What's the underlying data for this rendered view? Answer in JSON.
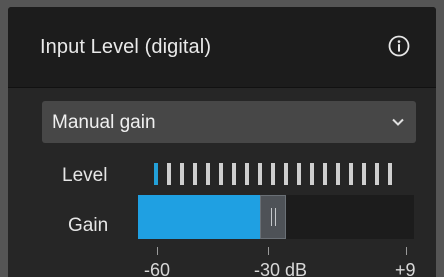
{
  "panel": {
    "title": "Input Level (digital)",
    "info_icon": "info-circle-icon"
  },
  "gain_mode": {
    "selected": "Manual gain",
    "chevron_icon": "chevron-down-icon"
  },
  "level": {
    "label": "Level",
    "segments_total": 19,
    "segments_active": 1,
    "active_color": "#23a0d8",
    "inactive_color": "#cfcfcf"
  },
  "gain": {
    "label": "Gain",
    "value_fraction": 0.47,
    "fill_color": "#1fa0e2"
  },
  "scale": {
    "ticks": [
      {
        "label": "-60",
        "fraction": 0.07
      },
      {
        "label": "-30 dB",
        "fraction": 0.47
      },
      {
        "label": "+9",
        "fraction": 0.97
      }
    ]
  }
}
